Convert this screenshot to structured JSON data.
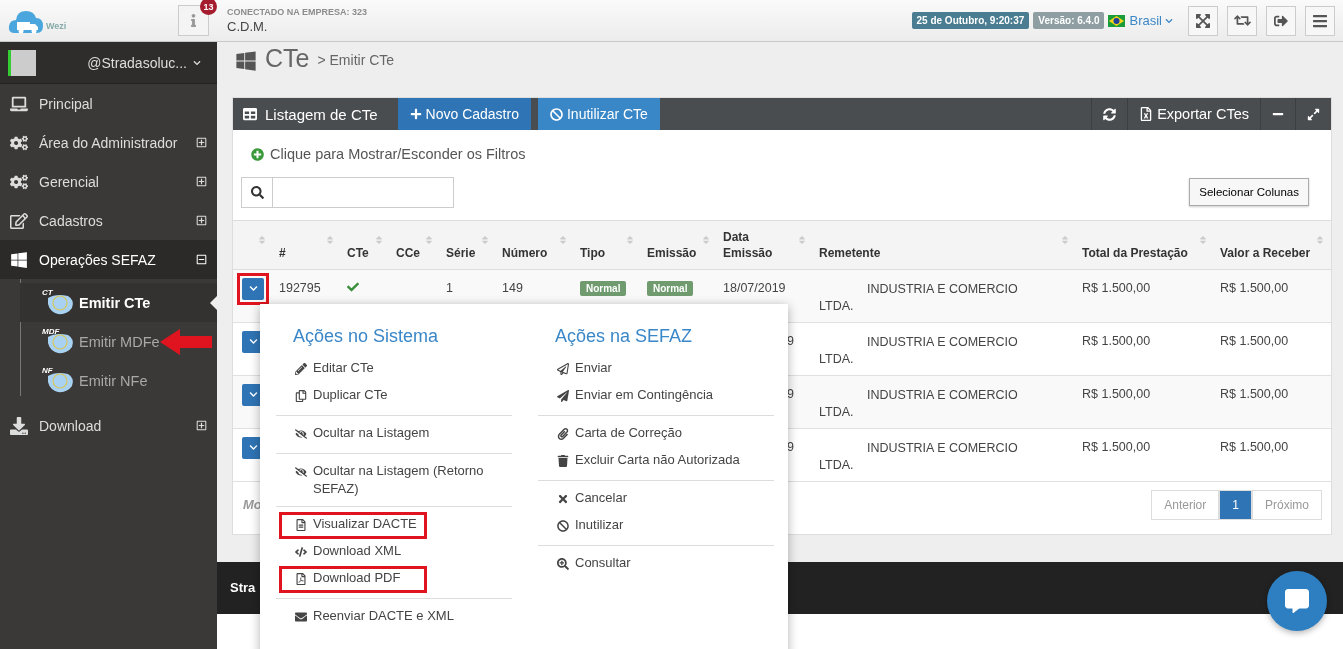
{
  "topbar": {
    "logo_text": "Wezi",
    "notifications": "13",
    "company_label": "CONECTADO NA EMPRESA: 323",
    "company_name": "C.D.M.",
    "datetime": "25 de Outubro, 9:20:37",
    "version": "Versão: 6.4.0",
    "region": "Brasil"
  },
  "sidebar": {
    "user": "@Stradasoluc...",
    "items": [
      {
        "label": "Principal",
        "selected": false
      },
      {
        "label": "Área do Administrador",
        "selected": false,
        "expanded": false
      },
      {
        "label": "Gerencial",
        "selected": false,
        "expanded": false
      },
      {
        "label": "Cadastros",
        "selected": false,
        "expanded": false
      },
      {
        "label": "Operações SEFAZ",
        "selected": true,
        "expanded": true,
        "children": [
          {
            "label": "Emitir CTe",
            "icon_label": "CT",
            "selected": true,
            "pointer": false
          },
          {
            "label": "Emitir MDFe",
            "icon_label": "MDF",
            "selected": false,
            "pointer": true
          },
          {
            "label": "Emitir NFe",
            "icon_label": "NF",
            "selected": false,
            "pointer": false
          }
        ]
      },
      {
        "label": "Download",
        "selected": false,
        "expanded": false
      }
    ]
  },
  "breadcrumb": {
    "section": "CTe",
    "page": "> Emitir CTe"
  },
  "panel": {
    "title": "Listagem de CTe",
    "buttons": [
      "Novo Cadastro",
      "Inutilizar CTe"
    ],
    "export": "Exportar CTes",
    "filter_toggle": "Clique para Mostrar/Esconder os Filtros",
    "columns_button": "Selecionar Colunas",
    "columns": [
      "#",
      "CTe",
      "CCe",
      "Série",
      "Número",
      "Tipo",
      "Emissão",
      "Data Emissão",
      "Remetente",
      "Total da Prestação",
      "Valor a Receber"
    ],
    "rows": [
      {
        "highlighted": true,
        "id": "192795",
        "cte_ok": true,
        "serie": "1",
        "numero": "149",
        "tipo": "Normal",
        "emissao": "Normal",
        "data": "18/07/2019",
        "remetente": "INDUSTRIA E COMERCIO LTDA.",
        "total": "R$ 1.500,00",
        "valor": "R$ 1.500,00"
      },
      {
        "highlighted": false,
        "data": "9",
        "remetente": "INDUSTRIA E COMERCIO LTDA.",
        "total": "R$ 1.500,00",
        "valor": "R$ 1.500,00"
      },
      {
        "highlighted": false,
        "data": "9",
        "remetente": "INDUSTRIA E COMERCIO LTDA.",
        "total": "R$ 1.500,00",
        "valor": "R$ 1.500,00"
      },
      {
        "highlighted": false,
        "data": "9",
        "remetente": "INDUSTRIA E COMERCIO LTDA.",
        "total": "R$ 1.500,00",
        "valor": "R$ 1.500,00"
      }
    ],
    "footer_info": "Mo",
    "pagination": [
      {
        "label": "Anterior",
        "selected": false
      },
      {
        "label": "1",
        "selected": true
      },
      {
        "label": "Próximo",
        "selected": false
      }
    ]
  },
  "actions_menu": {
    "columns": [
      {
        "title": "Ações no Sistema",
        "groups": [
          [
            {
              "label": "Editar CTe",
              "highlighted": false
            },
            {
              "label": "Duplicar CTe",
              "highlighted": false
            }
          ],
          [
            {
              "label": "Ocultar na Listagem",
              "highlighted": false
            }
          ],
          [
            {
              "label": "Ocultar na Listagem (Retorno SEFAZ)",
              "highlighted": false
            }
          ],
          [
            {
              "label": "Visualizar DACTE",
              "highlighted": true
            },
            {
              "label": "Download XML",
              "highlighted": false
            },
            {
              "label": "Download PDF",
              "highlighted": true
            }
          ],
          [
            {
              "label": "Reenviar DACTE e XML",
              "highlighted": false
            }
          ]
        ]
      },
      {
        "title": "Ações na SEFAZ",
        "groups": [
          [
            {
              "label": "Enviar",
              "highlighted": false
            },
            {
              "label": "Enviar em Contingência",
              "highlighted": false
            }
          ],
          [
            {
              "label": "Carta de Correção",
              "highlighted": false
            },
            {
              "label": "Excluir Carta não Autorizada",
              "highlighted": false
            }
          ],
          [
            {
              "label": "Cancelar",
              "highlighted": false
            },
            {
              "label": "Inutilizar",
              "highlighted": false
            }
          ],
          [
            {
              "label": "Consultar",
              "highlighted": false
            }
          ]
        ]
      }
    ]
  },
  "page_footer": "Stra"
}
